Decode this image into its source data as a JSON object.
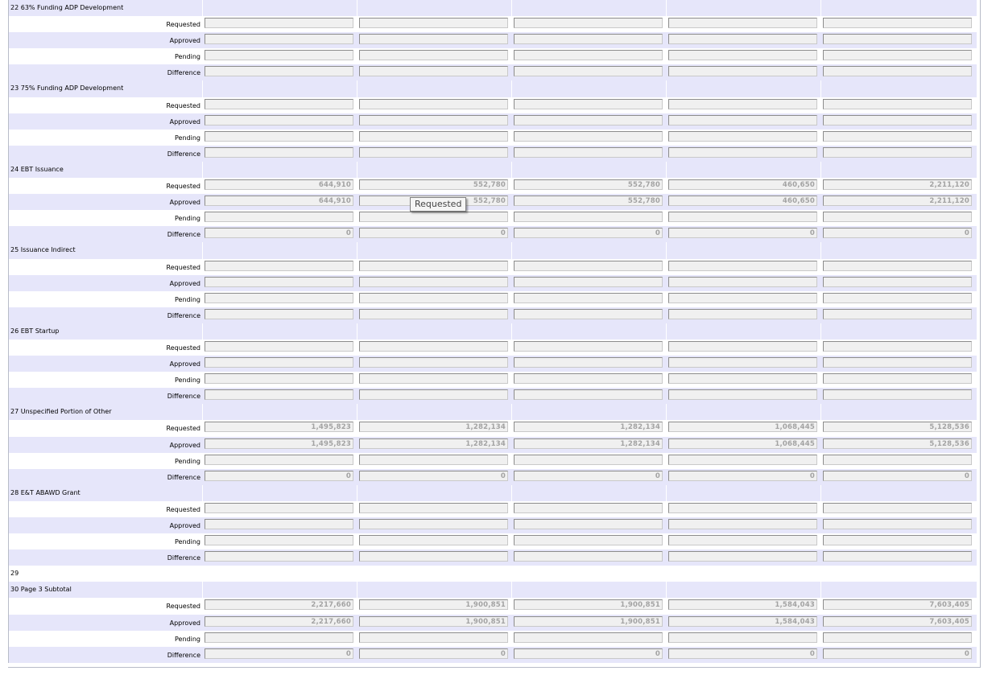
{
  "row_labels": {
    "requested": "Requested",
    "approved": "Approved",
    "pending": "Pending",
    "difference": "Difference"
  },
  "sections": [
    {
      "title": "22 63% Funding ADP Development",
      "requested": [
        "",
        "",
        "",
        "",
        ""
      ],
      "approved": [
        "",
        "",
        "",
        "",
        ""
      ],
      "pending": [
        "",
        "",
        "",
        "",
        ""
      ],
      "difference": [
        "",
        "",
        "",
        "",
        ""
      ]
    },
    {
      "title": "23 75% Funding ADP Development",
      "requested": [
        "",
        "",
        "",
        "",
        ""
      ],
      "approved": [
        "",
        "",
        "",
        "",
        ""
      ],
      "pending": [
        "",
        "",
        "",
        "",
        ""
      ],
      "difference": [
        "",
        "",
        "",
        "",
        ""
      ]
    },
    {
      "title": "24 EBT Issuance",
      "requested": [
        "644,910",
        "552,780",
        "552,780",
        "460,650",
        "2,211,120"
      ],
      "approved": [
        "644,910",
        "552,780",
        "552,780",
        "460,650",
        "2,211,120"
      ],
      "pending": [
        "",
        "",
        "",
        "",
        ""
      ],
      "difference": [
        "0",
        "0",
        "0",
        "0",
        "0"
      ]
    },
    {
      "title": "25 Issuance Indirect",
      "requested": [
        "",
        "",
        "",
        "",
        ""
      ],
      "approved": [
        "",
        "",
        "",
        "",
        ""
      ],
      "pending": [
        "",
        "",
        "",
        "",
        ""
      ],
      "difference": [
        "",
        "",
        "",
        "",
        ""
      ]
    },
    {
      "title": "26 EBT Startup",
      "requested": [
        "",
        "",
        "",
        "",
        ""
      ],
      "approved": [
        "",
        "",
        "",
        "",
        ""
      ],
      "pending": [
        "",
        "",
        "",
        "",
        ""
      ],
      "difference": [
        "",
        "",
        "",
        "",
        ""
      ]
    },
    {
      "title": "27 Unspecified Portion of Other",
      "requested": [
        "1,495,823",
        "1,282,134",
        "1,282,134",
        "1,068,445",
        "5,128,536"
      ],
      "approved": [
        "1,495,823",
        "1,282,134",
        "1,282,134",
        "1,068,445",
        "5,128,536"
      ],
      "pending": [
        "",
        "",
        "",
        "",
        ""
      ],
      "difference": [
        "0",
        "0",
        "0",
        "0",
        "0"
      ]
    },
    {
      "title": "28 E&T ABAWD Grant",
      "requested": [
        "",
        "",
        "",
        "",
        ""
      ],
      "approved": [
        "",
        "",
        "",
        "",
        ""
      ],
      "pending": [
        "",
        "",
        "",
        "",
        ""
      ],
      "difference": [
        "",
        "",
        "",
        "",
        ""
      ]
    },
    {
      "title": "29",
      "header_only": true
    },
    {
      "title": "30 Page 3 Subtotal",
      "requested": [
        "2,217,660",
        "1,900,851",
        "1,900,851",
        "1,584,043",
        "7,603,405"
      ],
      "approved": [
        "2,217,660",
        "1,900,851",
        "1,900,851",
        "1,584,043",
        "7,603,405"
      ],
      "pending": [
        "",
        "",
        "",
        "",
        ""
      ],
      "difference": [
        "0",
        "0",
        "0",
        "0",
        "0"
      ]
    }
  ],
  "tooltip": {
    "text": "Requested"
  }
}
